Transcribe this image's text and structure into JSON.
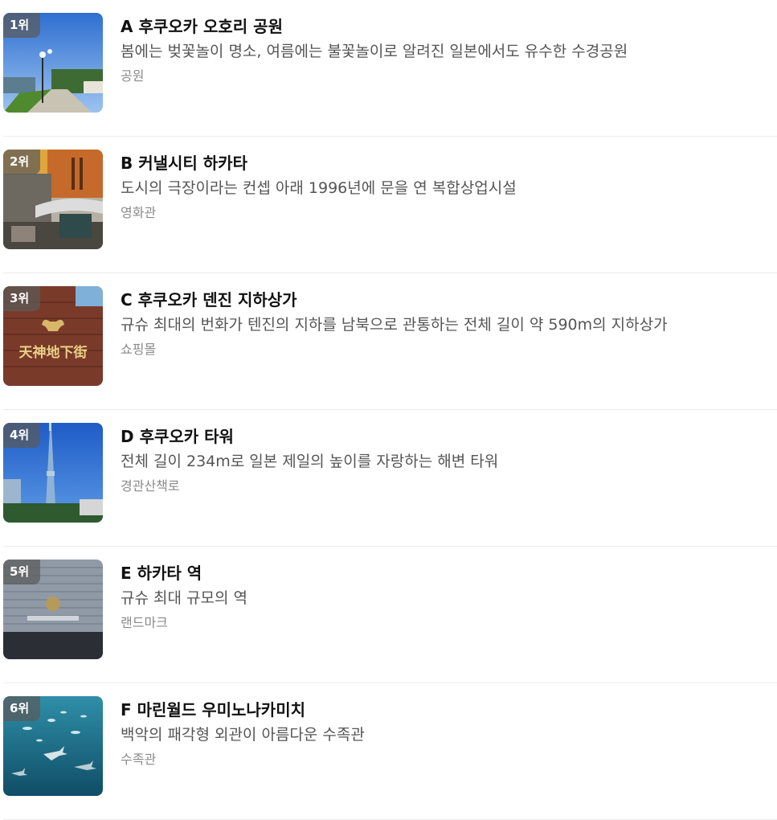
{
  "items": [
    {
      "rank": "1위",
      "title": "A 후쿠오카 오호리 공원",
      "description": "봄에는 벚꽃놀이 명소, 여름에는 불꽃놀이로 알려진 일본에서도 유수한 수경공원",
      "category": "공원",
      "image": "park-photo"
    },
    {
      "rank": "2위",
      "title": "B 커낼시티 하카타",
      "description": "도시의 극장이라는 컨셉 아래 1996년에 문을 연 복합상업시설",
      "category": "영화관",
      "image": "mall-photo"
    },
    {
      "rank": "3위",
      "title": "C 후쿠오카 덴진 지하상가",
      "description": "규슈 최대의 번화가 텐진의 지하를 남북으로 관통하는 전체 길이 약 590m의 지하상가",
      "category": "쇼핑몰",
      "image": "underground-mall-sign-photo",
      "image_sign_text": "天神地下街"
    },
    {
      "rank": "4위",
      "title": "D 후쿠오카 타워",
      "description": "전체 길이 234m로 일본 제일의 높이를 자랑하는 해변 타워",
      "category": "경관산책로",
      "image": "tower-photo"
    },
    {
      "rank": "5위",
      "title": "E 하카타 역",
      "description": "규슈 최대 규모의 역",
      "category": "랜드마크",
      "image": "station-photo"
    },
    {
      "rank": "6위",
      "title": "F 마린월드 우미노나카미치",
      "description": "백악의 패각형 외관이 아름다운 수족관",
      "category": "수족관",
      "image": "aquarium-photo"
    }
  ]
}
